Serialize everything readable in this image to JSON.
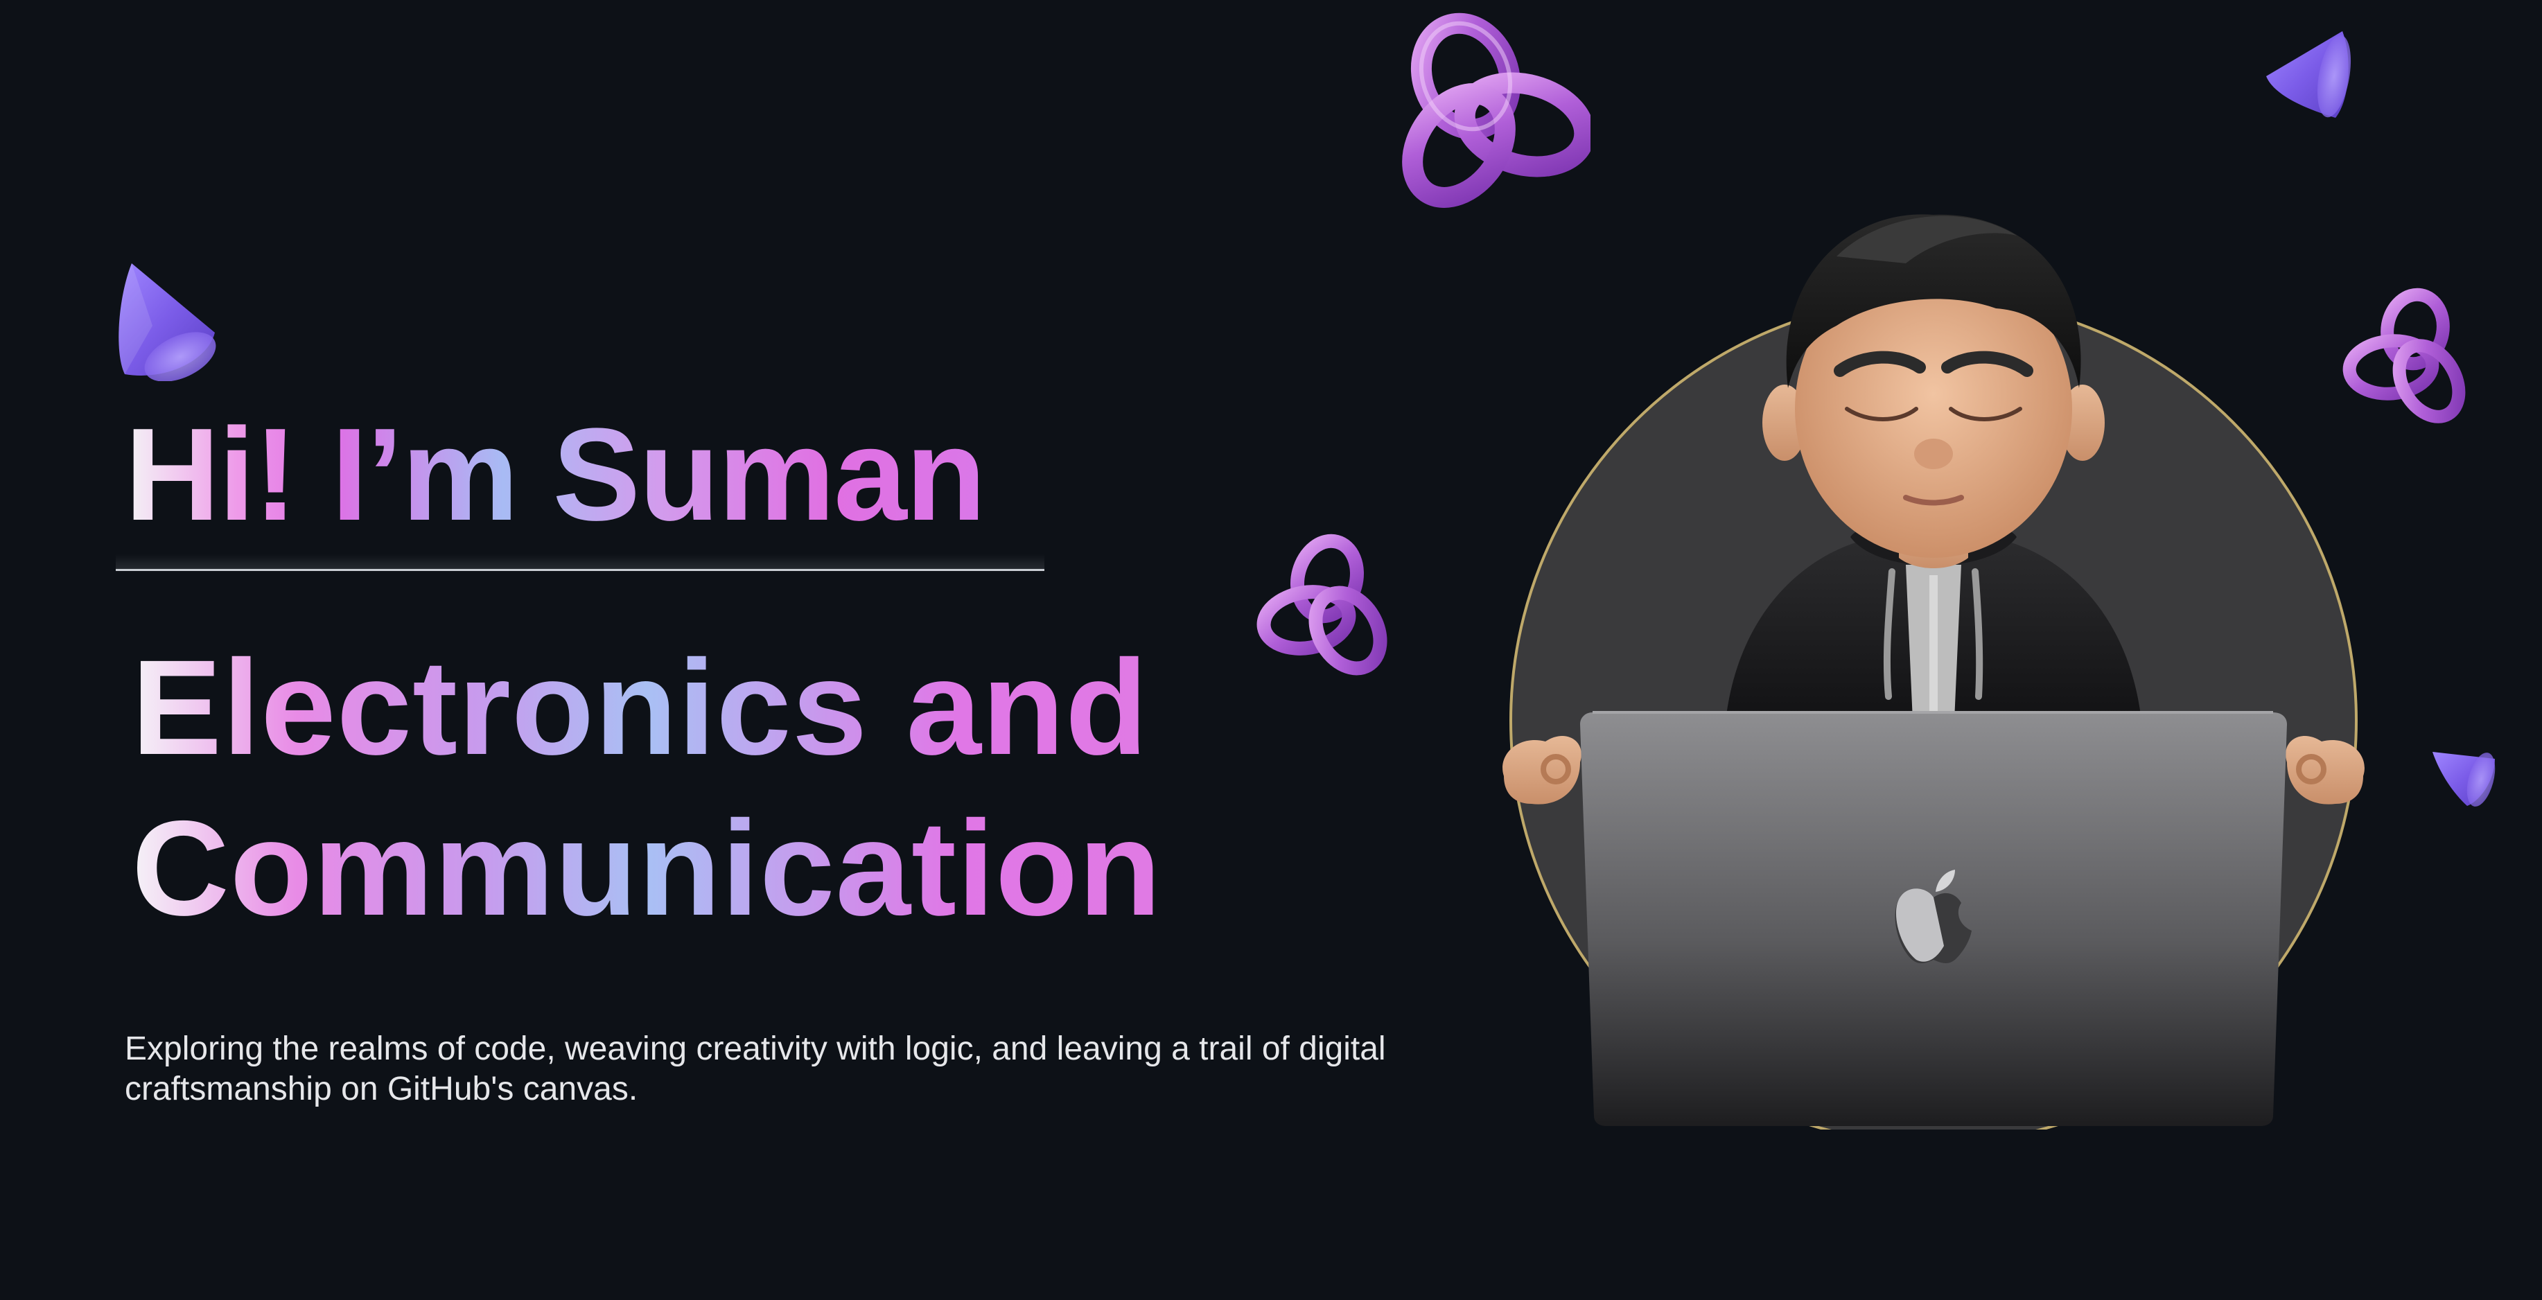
{
  "hero": {
    "greeting": "Hi! I’m Suman",
    "title_line1": "Electronics and",
    "title_line2": "Communication",
    "description": "Exploring the realms of code, weaving creativity with logic, and leaving a trail of digital craftsmanship on GitHub's canvas."
  },
  "theme": {
    "background": "#0d1117",
    "accent_pink": "#e070e2",
    "accent_blue": "#a9c0f4",
    "accent_purple": "#8b5cf6"
  },
  "decorations": {
    "shapes": [
      "cone-shape-icon",
      "trefoil-knot-icon",
      "trefoil-knot-icon",
      "cone-shape-icon",
      "trefoil-knot-icon",
      "cone-shape-icon"
    ],
    "avatar": "memoji-avatar-with-laptop",
    "laptop_logo": "apple-logo-icon"
  }
}
